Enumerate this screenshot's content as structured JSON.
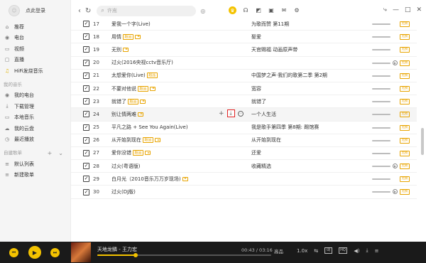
{
  "sidebar": {
    "login": "点此登录",
    "items": [
      {
        "label": "推荐",
        "icon": "home-icon"
      },
      {
        "label": "电台",
        "icon": "radio-icon"
      },
      {
        "label": "视频",
        "icon": "video-icon"
      },
      {
        "label": "直播",
        "icon": "tv-icon"
      },
      {
        "label": "HiFi发烧音乐",
        "icon": "hifi-icon"
      }
    ],
    "my_music_label": "我的音乐",
    "my_music": [
      {
        "label": "我的电台",
        "icon": "radio-icon"
      },
      {
        "label": "下载管理",
        "icon": "download-icon"
      },
      {
        "label": "本地音乐",
        "icon": "computer-icon"
      },
      {
        "label": "我的云盘",
        "icon": "cloud-icon"
      },
      {
        "label": "最近播放",
        "icon": "clock-icon"
      }
    ],
    "playlist_label": "自建歌单",
    "playlists": [
      {
        "label": "默认列表",
        "icon": "list-icon"
      },
      {
        "label": "新建歌单",
        "icon": "list-icon"
      }
    ]
  },
  "header": {
    "search_placeholder": "许嵩"
  },
  "songs": [
    {
      "num": "17",
      "title": "爱我一个字(Live)",
      "tags": [],
      "play": false,
      "album": "为歌而赞 第11期",
      "mv": false
    },
    {
      "num": "18",
      "title": "用情",
      "tags": [
        "超品"
      ],
      "play": true,
      "album": "娶爱",
      "mv": false
    },
    {
      "num": "19",
      "title": "无别",
      "tags": [],
      "play": true,
      "album": "天官赐福 动画原声带",
      "mv": false
    },
    {
      "num": "20",
      "title": "过火(2016央视cctv音乐厅)",
      "tags": [],
      "play": false,
      "album": "",
      "mv": true
    },
    {
      "num": "21",
      "title": "太想爱你(Live)",
      "tags": [
        "超品"
      ],
      "play": false,
      "album": "中国梦之声·我们的歌第二季 第2期",
      "mv": false
    },
    {
      "num": "22",
      "title": "不要对他说",
      "tags": [
        "超品"
      ],
      "play": true,
      "album": "宽容",
      "mv": false
    },
    {
      "num": "23",
      "title": "就错了",
      "tags": [
        "超品"
      ],
      "play": true,
      "album": "就错了",
      "mv": false
    },
    {
      "num": "24",
      "title": "别让情两难",
      "tags": [],
      "play": true,
      "album": "一个人生活",
      "mv": false,
      "hover": true
    },
    {
      "num": "25",
      "title": "平凡之路 + See You Again(Live)",
      "tags": [],
      "play": false,
      "album": "我是歌手第四季 第8期: 踢馆赛",
      "mv": false
    },
    {
      "num": "26",
      "title": "从开始到现在",
      "tags": [
        "超品"
      ],
      "play": true,
      "album": "从开始到现在",
      "mv": false
    },
    {
      "num": "27",
      "title": "爱你没错",
      "tags": [
        "超品"
      ],
      "play": true,
      "album": "还爱",
      "mv": false
    },
    {
      "num": "28",
      "title": "过火(粤语版)",
      "tags": [],
      "play": false,
      "album": "收藏精选",
      "mv": true
    },
    {
      "num": "29",
      "title": "白月光（2010音乐万万岁现场)",
      "tags": [],
      "play": true,
      "album": "",
      "mv": false
    },
    {
      "num": "30",
      "title": "过火(DJ版)",
      "tags": [],
      "play": false,
      "album": "",
      "mv": true
    }
  ],
  "row_badge": "无损",
  "player": {
    "title": "天地龙鳞 - 王力宏",
    "time": "00:43 / 03:16",
    "progress": 0.22,
    "quality": "高品",
    "speed": "1.0x",
    "lyric": "词",
    "hd": "HQ"
  },
  "colors": {
    "accent": "#f4c300",
    "tag": "#e8a400",
    "highlight": "#e02020",
    "player_bg": "#1a1a1a"
  }
}
